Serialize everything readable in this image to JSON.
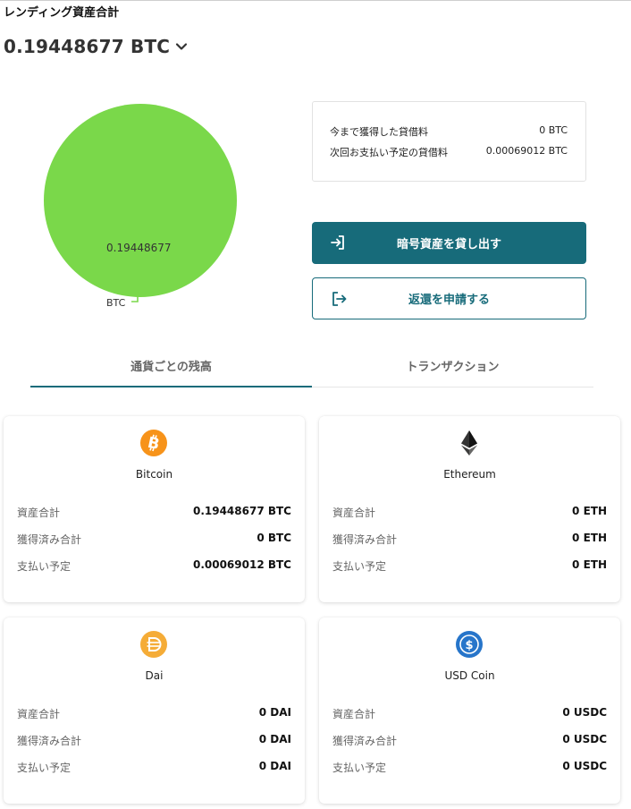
{
  "page": {
    "title": "レンディング資産合計"
  },
  "summary": {
    "total_value": "0.19448677 BTC"
  },
  "chart_data": {
    "type": "pie",
    "categories": [
      "BTC"
    ],
    "values": [
      0.19448677
    ],
    "data_labels": [
      "0.19448677"
    ],
    "colors": [
      "#7ad84a"
    ]
  },
  "info": {
    "earned_label": "今まで獲得した貸借料",
    "earned_value": "0 BTC",
    "next_label": "次回お支払い予定の貸借料",
    "next_value": "0.00069012 BTC"
  },
  "actions": {
    "lend_label": "暗号資産を貸し出す",
    "return_label": "返還を申請する"
  },
  "tabs": [
    {
      "label": "通貨ごとの残高",
      "active": true
    },
    {
      "label": "トランザクション",
      "active": false
    }
  ],
  "labels": {
    "total": "資産合計",
    "earned": "獲得済み合計",
    "scheduled": "支払い予定"
  },
  "cards": [
    {
      "name": "Bitcoin",
      "icon": "bitcoin-icon",
      "color": "#f7931a",
      "total": "0.19448677 BTC",
      "earned": "0 BTC",
      "scheduled": "0.00069012 BTC"
    },
    {
      "name": "Ethereum",
      "icon": "ethereum-icon",
      "color": "#343434",
      "total": "0 ETH",
      "earned": "0 ETH",
      "scheduled": "0 ETH"
    },
    {
      "name": "Dai",
      "icon": "dai-icon",
      "color": "#f5ac37",
      "total": "0 DAI",
      "earned": "0 DAI",
      "scheduled": "0 DAI"
    },
    {
      "name": "USD Coin",
      "icon": "usd-coin-icon",
      "color": "#2775ca",
      "total": "0 USDC",
      "earned": "0 USDC",
      "scheduled": "0 USDC"
    }
  ],
  "colors": {
    "brand": "#176b7a",
    "pie": "#7ad84a"
  }
}
